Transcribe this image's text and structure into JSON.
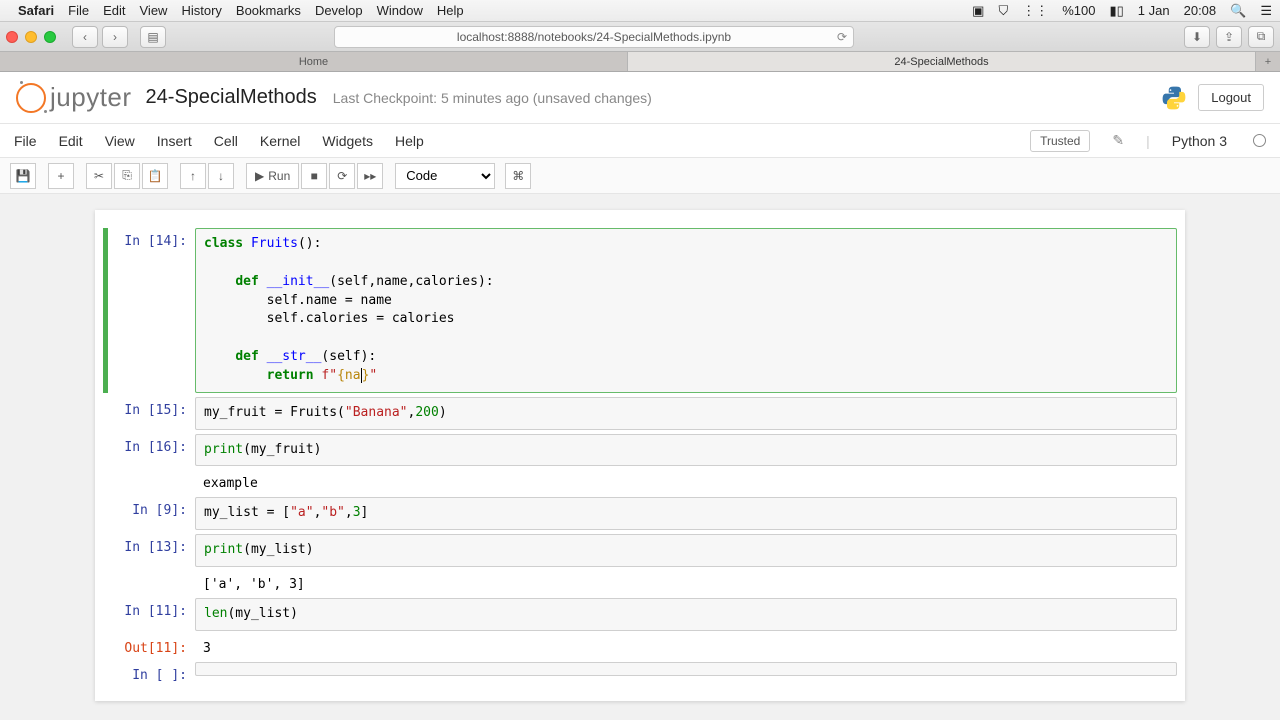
{
  "mac": {
    "app": "Safari",
    "menus": [
      "File",
      "Edit",
      "View",
      "History",
      "Bookmarks",
      "Develop",
      "Window",
      "Help"
    ],
    "battery": "%100",
    "date": "1 Jan",
    "time": "20:08"
  },
  "safari": {
    "url": "localhost:8888/notebooks/24-SpecialMethods.ipynb",
    "tabs": [
      {
        "label": "Home",
        "active": false
      },
      {
        "label": "24-SpecialMethods",
        "active": true
      }
    ]
  },
  "header": {
    "logo_text": "jupyter",
    "nb_name": "24-SpecialMethods",
    "checkpoint": "Last Checkpoint: 5 minutes ago  (unsaved changes)",
    "logout": "Logout"
  },
  "menubar": {
    "items": [
      "File",
      "Edit",
      "View",
      "Insert",
      "Cell",
      "Kernel",
      "Widgets",
      "Help"
    ],
    "trusted": "Trusted",
    "kernel": "Python 3"
  },
  "toolbar": {
    "run": "Run",
    "cell_type": "Code"
  },
  "cells": [
    {
      "prompt": "In [14]:",
      "selected": true,
      "code_html": "<span class='kw'>class</span> <span class='fn'>Fruits</span>():\n\n    <span class='kw'>def</span> <span class='fn'>__init__</span>(<span class='nm'>self</span>,name,calories):\n        <span class='nm'>self</span>.name = name\n        <span class='nm'>self</span>.calories = calories\n\n    <span class='kw'>def</span> <span class='fn'>__str__</span>(<span class='nm'>self</span>):\n        <span class='kw'>return</span> <span class='fstr'>f\"</span><span class='interp'>{na<span class='cursor'></span>}</span><span class='fstr'>\"</span>"
    },
    {
      "prompt": "In [15]:",
      "code_html": "my_fruit = Fruits(<span class='str'>\"Banana\"</span>,<span class='num'>200</span>)"
    },
    {
      "prompt": "In [16]:",
      "code_html": "<span class='bi'>print</span>(my_fruit)",
      "output": "example"
    },
    {
      "prompt": "In [9]:",
      "code_html": "my_list = [<span class='str'>\"a\"</span>,<span class='str'>\"b\"</span>,<span class='num'>3</span>]"
    },
    {
      "prompt": "In [13]:",
      "code_html": "<span class='bi'>print</span>(my_list)",
      "output": "['a', 'b', 3]"
    },
    {
      "prompt": "In [11]:",
      "code_html": "<span class='bi'>len</span>(my_list)",
      "out_prompt": "Out[11]:",
      "out_val": "3"
    },
    {
      "prompt": "In [ ]:",
      "code_html": ""
    }
  ]
}
